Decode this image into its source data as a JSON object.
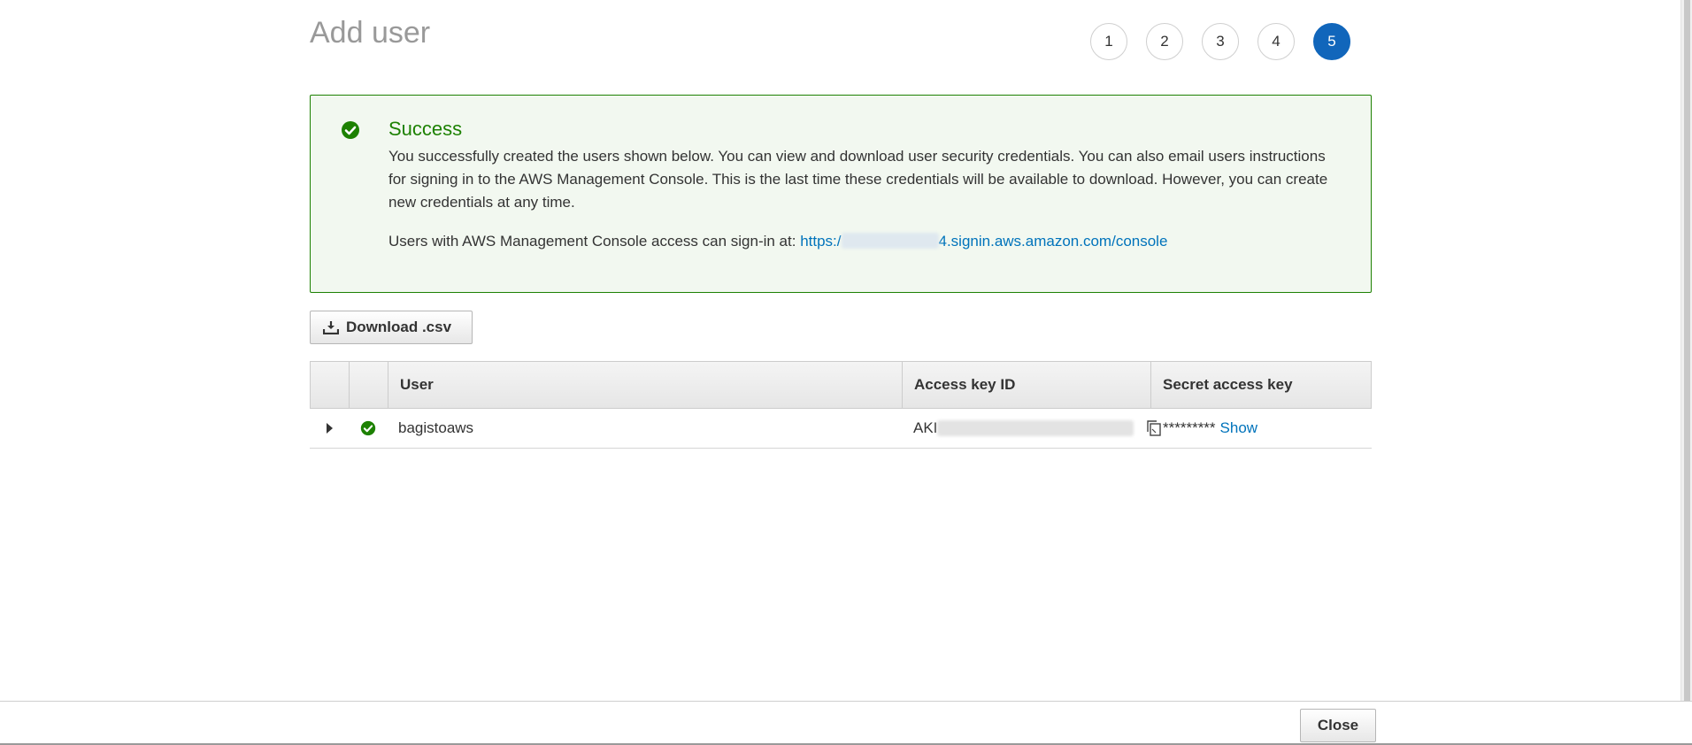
{
  "header": {
    "title": "Add user",
    "steps": [
      "1",
      "2",
      "3",
      "4",
      "5"
    ],
    "active_step": "5"
  },
  "alert": {
    "title": "Success",
    "message": "You successfully created the users shown below. You can view and download user security credentials. You can also email users instructions for signing in to the AWS Management Console. This is the last time these credentials will be available to download. However, you can create new credentials at any time.",
    "signin_prefix": "Users with AWS Management Console access can sign-in at: ",
    "signin_url_start": "https:/",
    "signin_url_end": "4.signin.aws.amazon.com/console",
    "success_color": "#1d8102"
  },
  "toolbar": {
    "download_label": "Download .csv"
  },
  "table": {
    "columns": {
      "user": "User",
      "access_key_id": "Access key ID",
      "secret_access_key": "Secret access key"
    },
    "rows": [
      {
        "user": "bagistoaws",
        "access_key_prefix": "AKI",
        "secret_masked": "*********",
        "show_label": "Show"
      }
    ]
  },
  "footer": {
    "close_label": "Close"
  },
  "colors": {
    "accent": "#1166bb",
    "link": "#0073bb",
    "success": "#1d8102"
  },
  "icons": {
    "success": "check-circle-icon",
    "download": "download-icon",
    "copy": "copy-icon",
    "expand": "caret-right-icon"
  }
}
